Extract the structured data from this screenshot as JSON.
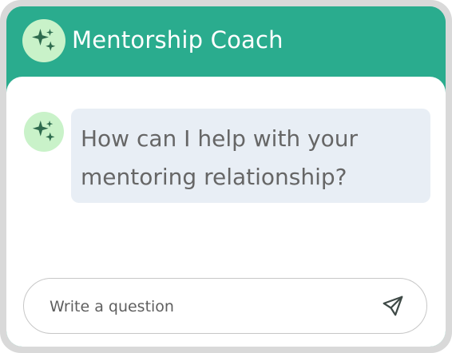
{
  "header": {
    "title": "Mentorship Coach",
    "avatar_icon": "sparkles-icon"
  },
  "messages": [
    {
      "role": "assistant",
      "avatar_icon": "sparkles-icon",
      "text": "How can I help with your mentoring relationship?"
    }
  ],
  "composer": {
    "placeholder": "Write a question",
    "send_icon": "send-icon"
  },
  "colors": {
    "accent": "#2aac8e",
    "avatar_bg": "#c9f2c9",
    "sparkle": "#2e6b4e",
    "bubble_bg": "#e8eef5",
    "frame": "#d9d9d9"
  }
}
